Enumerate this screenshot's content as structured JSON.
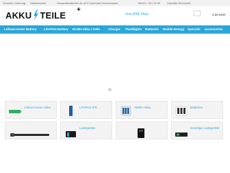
{
  "topbar": {
    "items": [
      "Schnelle Lieferung",
      "Käuferschutz",
      "Versandkostenfrei ab 40 € innerhalb Deutschlands",
      "06021 / 321 22 62",
      "Geprüfte Sicherheit"
    ]
  },
  "logo": {
    "left": "AKKU",
    "right": "TEILE",
    "plus": "+"
  },
  "b2b_link": "Zum B2B Shop",
  "cart": {
    "price": "0,00 EUR"
  },
  "nav": {
    "items": [
      "Lithium-Ionen Battery",
      "LiFePO4 Battery",
      "Ni-MH Akku / Zelle",
      "Charger",
      "Flashlights",
      "Batterien",
      "Mobile Energy",
      "Specials",
      "accessories"
    ]
  },
  "categories": [
    {
      "label": "Lithium-Ionen Akku"
    },
    {
      "label": "LiFePo4 IFR"
    },
    {
      "label": "NiMH-Akku"
    },
    {
      "label": "Batterien"
    },
    {
      "label": ""
    },
    {
      "label": "Ladegeräte"
    },
    {
      "label": ""
    },
    {
      "label": "Sonstige Ladegeräte"
    }
  ],
  "colors": {
    "brand": "#2aa6d9",
    "topbar_bg": "#f1f1f1",
    "card_bg": "#f3f3f3"
  }
}
